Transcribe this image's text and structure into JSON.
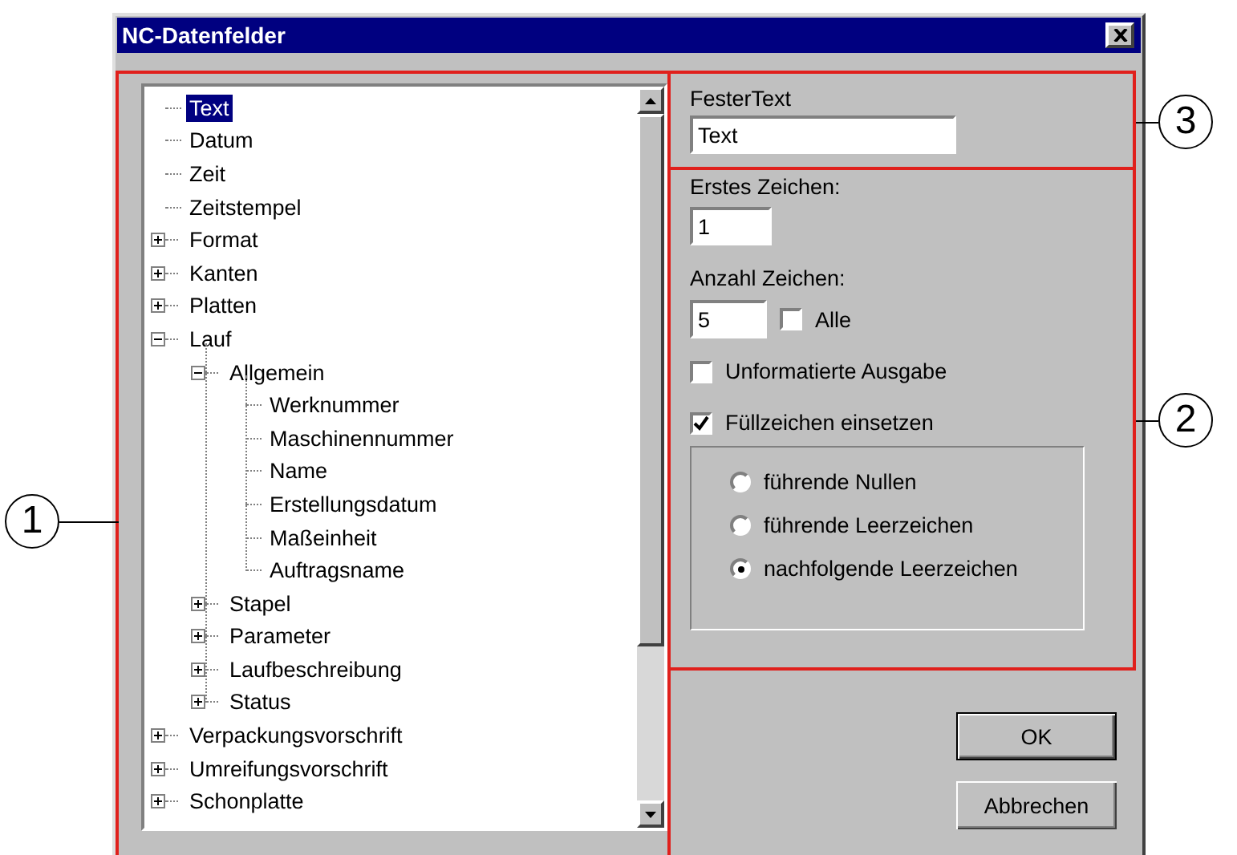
{
  "window": {
    "title": "NC-Datenfelder"
  },
  "tree": {
    "items": [
      {
        "label": "Text",
        "selected": true
      },
      {
        "label": "Datum",
        "selected": false
      },
      {
        "label": "Zeit",
        "selected": false
      },
      {
        "label": "Zeitstempel",
        "selected": false
      },
      {
        "label": "Format",
        "selected": false,
        "expanded": false
      },
      {
        "label": "Kanten",
        "selected": false,
        "expanded": false
      },
      {
        "label": "Platten",
        "selected": false,
        "expanded": false
      },
      {
        "label": "Lauf",
        "selected": false,
        "expanded": true,
        "children": [
          {
            "label": "Allgemein",
            "selected": false,
            "expanded": true,
            "children": [
              {
                "label": "Werknummer",
                "selected": false
              },
              {
                "label": "Maschinennummer",
                "selected": false
              },
              {
                "label": "Name",
                "selected": false
              },
              {
                "label": "Erstellungsdatum",
                "selected": false
              },
              {
                "label": "Maßeinheit",
                "selected": false
              },
              {
                "label": "Auftragsname",
                "selected": false
              }
            ]
          },
          {
            "label": "Stapel",
            "selected": false,
            "expanded": false
          },
          {
            "label": "Parameter",
            "selected": false,
            "expanded": false
          },
          {
            "label": "Laufbeschreibung",
            "selected": false,
            "expanded": false
          },
          {
            "label": "Status",
            "selected": false,
            "expanded": false
          }
        ]
      },
      {
        "label": "Verpackungsvorschrift",
        "selected": false,
        "expanded": false
      },
      {
        "label": "Umreifungsvorschrift",
        "selected": false,
        "expanded": false
      },
      {
        "label": "Schonplatte",
        "selected": false,
        "expanded": false
      }
    ]
  },
  "fixed_text": {
    "label": "FesterText",
    "value": "Text"
  },
  "first_char": {
    "label": "Erstes Zeichen:",
    "value": "1"
  },
  "char_count": {
    "label": "Anzahl Zeichen:",
    "value": "5"
  },
  "all_option": {
    "label": "Alle",
    "checked": false
  },
  "options": [
    {
      "label": "Unformatierte Ausgabe",
      "checked": false
    },
    {
      "label": "Füllzeichen einsetzen",
      "checked": true
    }
  ],
  "fill_mode": [
    {
      "label": "führende Nullen",
      "selected": false
    },
    {
      "label": "führende Leerzeichen",
      "selected": false
    },
    {
      "label": "nachfolgende Leerzeichen",
      "selected": true
    }
  ],
  "buttons": [
    {
      "label": "OK",
      "default": true
    },
    {
      "label": "Abbrechen",
      "default": false
    }
  ],
  "callouts": [
    {
      "label": "1"
    },
    {
      "label": "2"
    },
    {
      "label": "3"
    }
  ]
}
